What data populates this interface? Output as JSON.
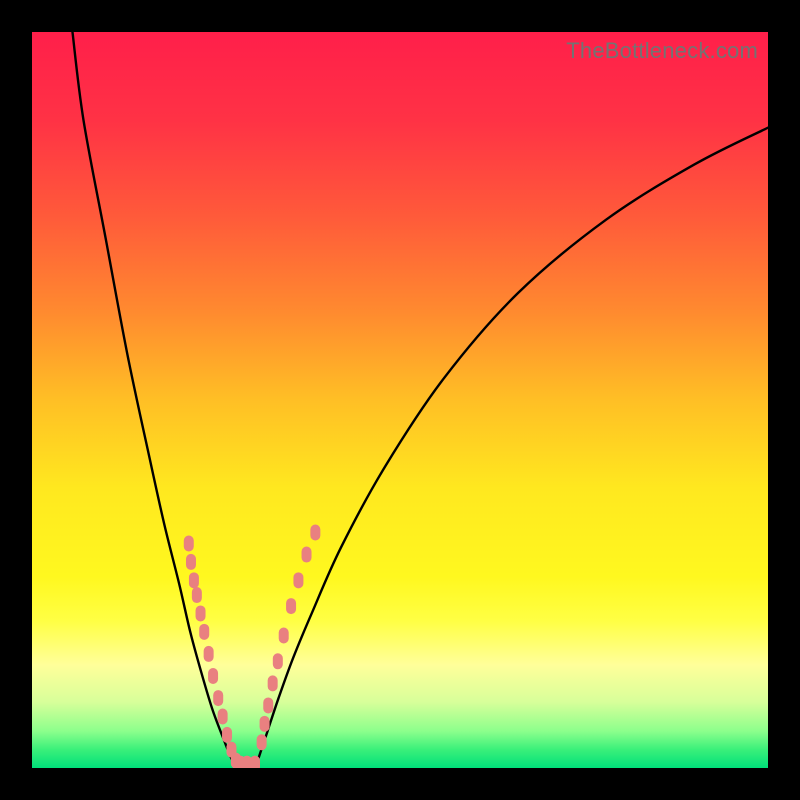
{
  "watermark": "TheBottleneck.com",
  "gradient_stops": [
    {
      "offset": 0.0,
      "color": "#ff1f4a"
    },
    {
      "offset": 0.12,
      "color": "#ff3245"
    },
    {
      "offset": 0.25,
      "color": "#ff5a3a"
    },
    {
      "offset": 0.38,
      "color": "#ff8a2f"
    },
    {
      "offset": 0.5,
      "color": "#ffbf25"
    },
    {
      "offset": 0.62,
      "color": "#ffe81f"
    },
    {
      "offset": 0.74,
      "color": "#fff81f"
    },
    {
      "offset": 0.8,
      "color": "#ffff44"
    },
    {
      "offset": 0.86,
      "color": "#ffff9a"
    },
    {
      "offset": 0.91,
      "color": "#d8ff9a"
    },
    {
      "offset": 0.95,
      "color": "#8cff8c"
    },
    {
      "offset": 0.975,
      "color": "#3af07a"
    },
    {
      "offset": 1.0,
      "color": "#00e07a"
    }
  ],
  "dot_color": "#e98080",
  "chart_data": {
    "type": "line",
    "title": "",
    "xlabel": "",
    "ylabel": "",
    "xlim": [
      0,
      100
    ],
    "ylim": [
      0,
      100
    ],
    "note": "Two monotone curves meeting near bottom; axes unlabeled; values estimated from pixel positions.",
    "series": [
      {
        "name": "left-curve",
        "x": [
          5.5,
          7.0,
          10.0,
          13.0,
          16.0,
          18.0,
          20.0,
          21.5,
          23.0,
          24.5,
          26.0,
          27.0,
          27.8
        ],
        "y": [
          100,
          88,
          72,
          56,
          42,
          33,
          25,
          18.5,
          13.0,
          8.0,
          4.0,
          1.5,
          0.0
        ]
      },
      {
        "name": "right-curve",
        "x": [
          30.5,
          31.0,
          32.0,
          33.5,
          35.5,
          38.0,
          42.0,
          48.0,
          56.0,
          66.0,
          78.0,
          90.0,
          100.0
        ],
        "y": [
          0.5,
          2.0,
          5.0,
          9.5,
          15.0,
          21.0,
          30.0,
          41.0,
          53.0,
          64.5,
          74.5,
          82.0,
          87.0
        ]
      }
    ],
    "dot_clusters": [
      {
        "name": "left-branch-dots",
        "points": [
          [
            21.3,
            30.5
          ],
          [
            21.6,
            28.0
          ],
          [
            22.0,
            25.5
          ],
          [
            22.4,
            23.5
          ],
          [
            22.9,
            21.0
          ],
          [
            23.4,
            18.5
          ],
          [
            24.0,
            15.5
          ],
          [
            24.6,
            12.5
          ],
          [
            25.3,
            9.5
          ],
          [
            25.9,
            7.0
          ],
          [
            26.5,
            4.5
          ],
          [
            27.1,
            2.5
          ],
          [
            27.7,
            1.0
          ],
          [
            28.3,
            0.6
          ],
          [
            29.2,
            0.6
          ],
          [
            30.3,
            0.6
          ]
        ]
      },
      {
        "name": "right-branch-dots",
        "points": [
          [
            31.2,
            3.5
          ],
          [
            31.6,
            6.0
          ],
          [
            32.1,
            8.5
          ],
          [
            32.7,
            11.5
          ],
          [
            33.4,
            14.5
          ],
          [
            34.2,
            18.0
          ],
          [
            35.2,
            22.0
          ],
          [
            36.2,
            25.5
          ],
          [
            37.3,
            29.0
          ],
          [
            38.5,
            32.0
          ]
        ]
      }
    ]
  }
}
